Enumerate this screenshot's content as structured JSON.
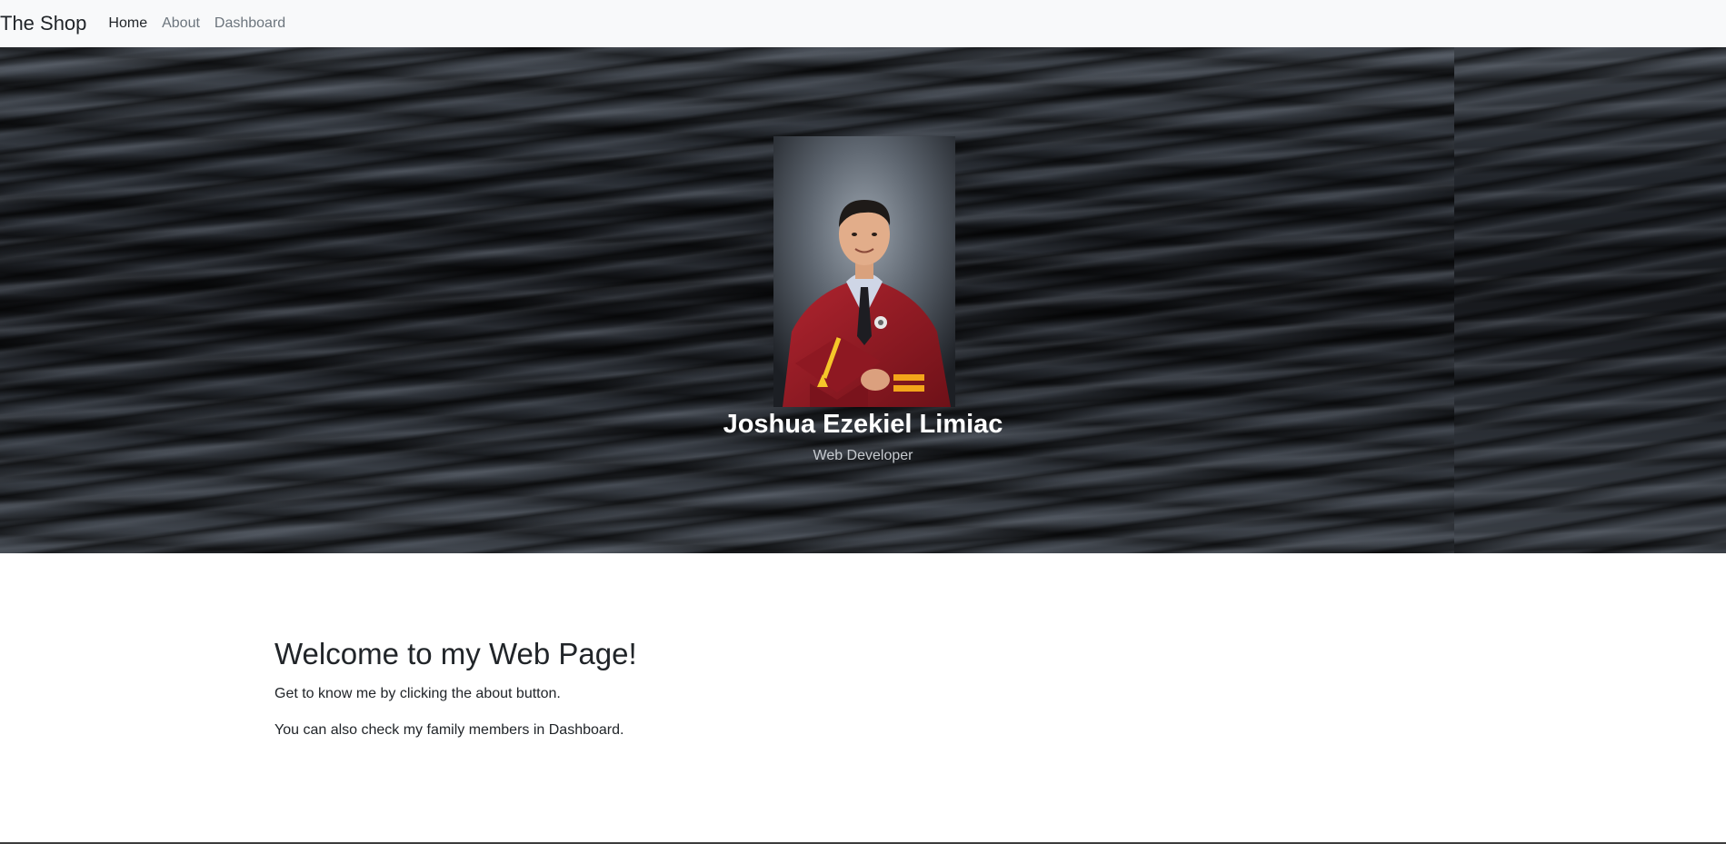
{
  "navbar": {
    "brand": "The Shop",
    "links": [
      {
        "label": "Home",
        "active": true
      },
      {
        "label": "About",
        "active": false
      },
      {
        "label": "Dashboard",
        "active": false
      }
    ]
  },
  "hero": {
    "name": "Joshua Ezekiel Limiac",
    "role": "Web Developer",
    "photo_icon": "graduation-portrait"
  },
  "main": {
    "title": "Welcome to my Web Page!",
    "paragraphs": [
      "Get to know me by clicking the about button.",
      "You can also check my family members in Dashboard."
    ]
  },
  "colors": {
    "navbar_bg": "#f8f9fa",
    "active_link": "#212529",
    "inactive_link": "#6c757d",
    "hero_text": "#ffffff",
    "role_text": "#c7cbd0"
  }
}
